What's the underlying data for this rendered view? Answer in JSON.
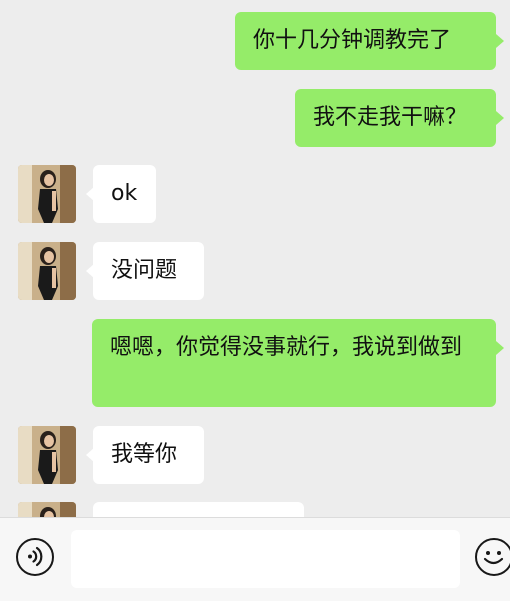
{
  "messages": [
    {
      "side": "me",
      "text": "你十几分钟调教完了"
    },
    {
      "side": "me",
      "text": "我不走我干嘛？"
    },
    {
      "side": "them",
      "text": "ok"
    },
    {
      "side": "them",
      "text": "没问题"
    },
    {
      "side": "me",
      "text": "嗯嗯，你觉得没事就行，我说到做到"
    },
    {
      "side": "them",
      "text": "我等你"
    },
    {
      "side": "them",
      "text": ""
    }
  ],
  "input": {
    "value": "",
    "placeholder": ""
  },
  "icons": {
    "voice": "voice-wave-icon",
    "emoji": "smiley-icon"
  },
  "colors": {
    "background": "#ededed",
    "my_bubble": "#95ec69",
    "their_bubble": "#ffffff"
  }
}
